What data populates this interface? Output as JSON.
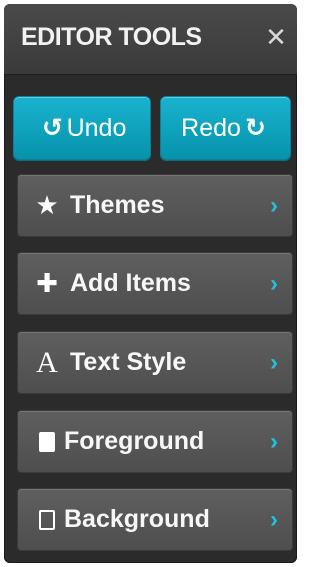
{
  "header": {
    "title": "EDITOR TOOLS",
    "close_glyph": "✕",
    "close_icon": "close-icon"
  },
  "toolbar": {
    "undo": {
      "label": "Undo",
      "icon": "undo-icon",
      "glyph": "↻"
    },
    "redo": {
      "label": "Redo",
      "icon": "redo-icon",
      "glyph": "↻"
    },
    "accent_color": "#0aa7c2"
  },
  "menu": [
    {
      "label": "Themes",
      "icon": "star-icon",
      "glyph": "★",
      "chevron": "›"
    },
    {
      "label": "Add Items",
      "icon": "plus-icon",
      "glyph": "✚",
      "chevron": "›"
    },
    {
      "label": "Text Style",
      "icon": "text-style-icon",
      "glyph": "A",
      "chevron": "›"
    },
    {
      "label": "Foreground",
      "icon": "foreground-icon",
      "glyph": "",
      "chevron": "›"
    },
    {
      "label": "Background",
      "icon": "background-icon",
      "glyph": "",
      "chevron": "›"
    }
  ],
  "colors": {
    "panel": "#2b2b2b",
    "item": "#575757",
    "chevron": "#1fc2e0",
    "text": "#f7f7f7"
  }
}
